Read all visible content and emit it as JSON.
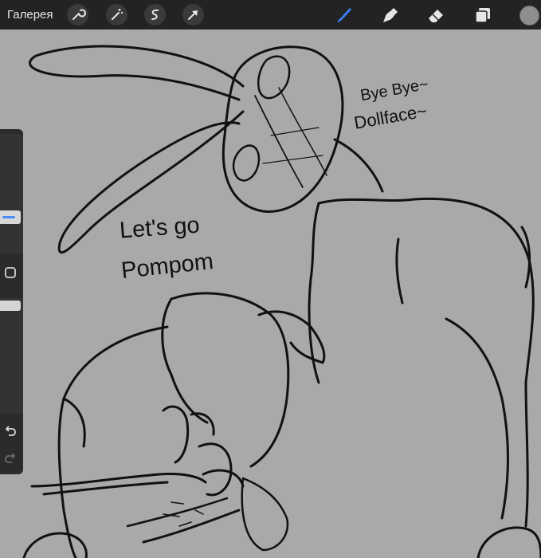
{
  "toolbar": {
    "gallery_label": "Галерея",
    "actions": [
      "wrench-icon",
      "magic-wand-icon",
      "selection-icon",
      "transform-arrow-icon"
    ],
    "tools": [
      "brush-icon",
      "smudge-icon",
      "eraser-icon",
      "layers-icon"
    ],
    "active_tool": "brush-icon",
    "active_tool_color": "#3b82f6",
    "current_color": "#8f8f8f"
  },
  "canvas": {
    "background": "#a9a9a9",
    "speech_1_line1": "Let's go",
    "speech_1_line2": "Pompom",
    "speech_2_line1": "Bye Bye~",
    "speech_2_line2": "Dollface~"
  },
  "sidebar": {
    "brush_size_level": 0.22,
    "opacity_level": 0.0,
    "buttons": [
      "modify-square-icon",
      "undo-icon",
      "redo-icon"
    ]
  }
}
